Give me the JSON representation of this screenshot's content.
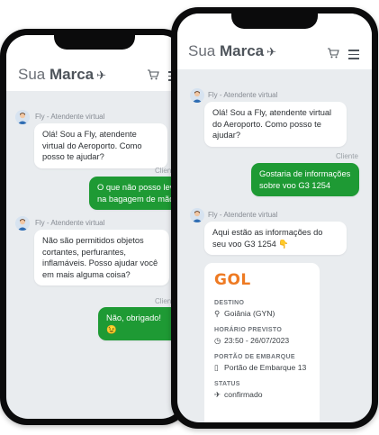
{
  "brand": {
    "name_light": "Sua",
    "name_bold": "Marca"
  },
  "left_phone": {
    "agent_label": "Fly - Atendente virtual",
    "client_label": "Cliente",
    "messages": [
      "Olá! Sou a Fly, atendente virtual do Aeroporto. Como posso te ajudar?",
      "O que não posso levar na bagagem de mão?",
      "Não são permitidos objetos cortantes, perfurantes, inflamáveis. Posso ajudar você em mais alguma coisa?",
      "Não, obrigado! 😉"
    ]
  },
  "right_phone": {
    "agent_label": "Fly - Atendente virtual",
    "client_label": "Cliente",
    "messages": [
      "Olá! Sou a Fly, atendente virtual do Aeroporto. Como posso te ajudar?",
      "Gostaria de informações sobre voo G3 1254",
      "Aqui estão as informações do seu voo G3 1254 👇"
    ],
    "flight_card": {
      "airline": "GOL",
      "destino_label": "DESTINO",
      "destino": "Goiânia (GYN)",
      "horario_label": "HORÁRIO PREVISTO",
      "horario": "23:50 - 26/07/2023",
      "portao_label": "PORTÃO DE EMBARQUE",
      "portao": "Portão de Embarque 13",
      "status_label": "STATUS",
      "status": "confirmado"
    }
  },
  "colors": {
    "outgoing_bubble": "#1e9a34",
    "airline_brand": "#ee7a23",
    "chat_background": "#e9ecef"
  },
  "icons": [
    "plane-icon",
    "cart-icon",
    "menu-icon",
    "avatar-icon",
    "location-pin-icon",
    "clock-icon",
    "gate-icon",
    "plane-status-icon"
  ]
}
